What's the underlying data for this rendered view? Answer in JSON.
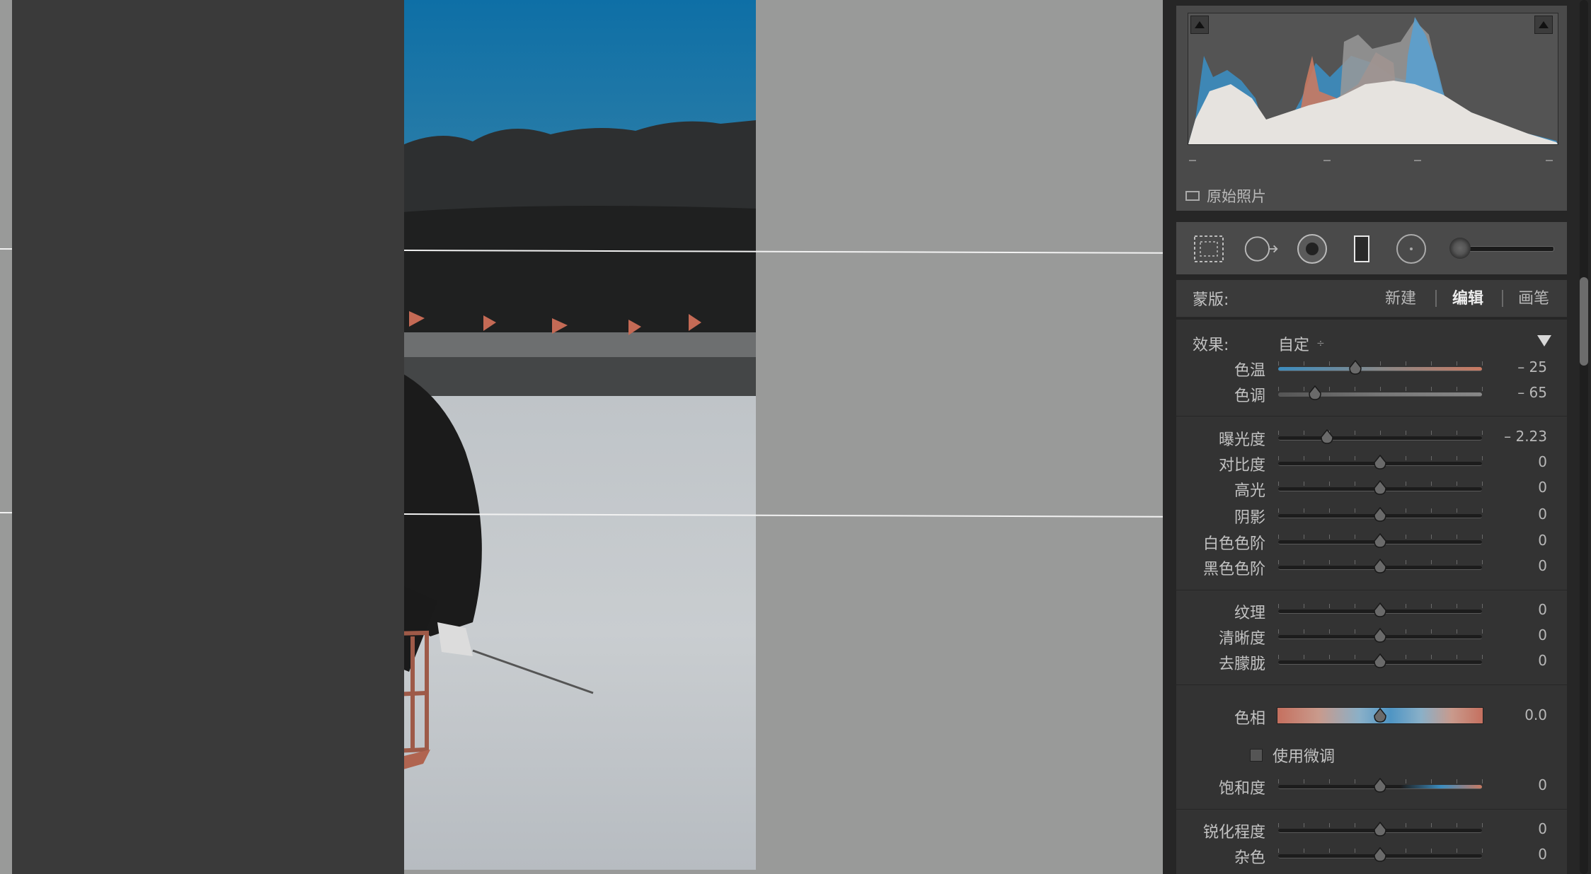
{
  "histogram": {
    "original_photo_label": "原始照片",
    "tick_labels": [
      "–",
      "–",
      "–",
      "–"
    ]
  },
  "mask": {
    "label": "蒙版:",
    "new": "新建",
    "edit": "编辑",
    "brush": "画笔"
  },
  "effect": {
    "label": "效果:",
    "value": "自定",
    "value_suffix": "÷"
  },
  "sliders": {
    "temp": {
      "label": "色温",
      "value": "– 25",
      "level": 0.38
    },
    "tint": {
      "label": "色调",
      "value": "– 65",
      "level": 0.18
    },
    "exposure": {
      "label": "曝光度",
      "value": "– 2.23",
      "level": 0.24
    },
    "contrast": {
      "label": "对比度",
      "value": "0",
      "level": 0.5
    },
    "highlights": {
      "label": "高光",
      "value": "0",
      "level": 0.5
    },
    "shadows": {
      "label": "阴影",
      "value": "0",
      "level": 0.5
    },
    "whites": {
      "label": "白色色阶",
      "value": "0",
      "level": 0.5
    },
    "blacks": {
      "label": "黑色色阶",
      "value": "0",
      "level": 0.5
    },
    "texture": {
      "label": "纹理",
      "value": "0",
      "level": 0.5
    },
    "clarity": {
      "label": "清晰度",
      "value": "0",
      "level": 0.5
    },
    "dehaze": {
      "label": "去朦胧",
      "value": "0",
      "level": 0.5
    },
    "hue": {
      "label": "色相",
      "value": "0.0",
      "level": 0.5
    },
    "saturation": {
      "label": "饱和度",
      "value": "0",
      "level": 0.5
    },
    "sharpness": {
      "label": "锐化程度",
      "value": "0",
      "level": 0.5
    },
    "noise": {
      "label": "杂色",
      "value": "0",
      "level": 0.5
    }
  },
  "fine_tune": {
    "label": "使用微调"
  },
  "colors": {
    "panel": "#3a3a3a",
    "accent_blue": "#3c8dc0",
    "accent_orange": "#c97a62"
  }
}
